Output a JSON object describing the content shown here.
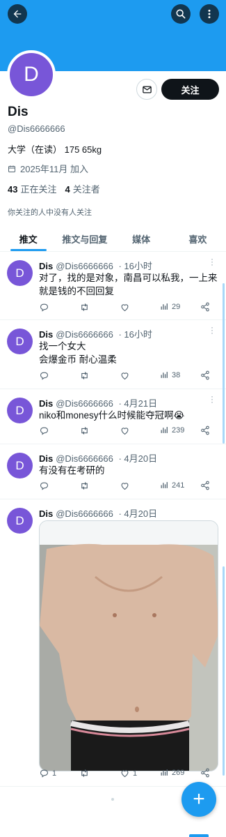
{
  "header": {
    "banner_color": "#1d9bf0",
    "back_icon": "arrow-left-icon",
    "search_icon": "search-icon",
    "more_icon": "more-vertical-icon"
  },
  "profile": {
    "avatar_letter": "D",
    "avatar_color": "#7856d8",
    "name": "Dis",
    "handle": "@Dis6666666",
    "bio": "大学（在读） 175 65kg",
    "joined": "2025年11月 加入",
    "following_count": "43",
    "following_label": "正在关注",
    "followers_count": "4",
    "followers_label": "关注者",
    "mutual_note": "你关注的人中没有人关注",
    "follow_label": "关注",
    "message_icon": "mail-icon"
  },
  "tabs": [
    {
      "label": "推文",
      "active": true
    },
    {
      "label": "推文与回复",
      "active": false
    },
    {
      "label": "媒体",
      "active": false
    },
    {
      "label": "喜欢",
      "active": false
    }
  ],
  "tweets": [
    {
      "name": "Dis",
      "handle": "@Dis6666666",
      "time": "16小时",
      "lines": [
        "对了，找的是对象，南昌可以私我，一上来就是钱的不回回复"
      ],
      "replies": "",
      "retweets": "",
      "likes": "",
      "views": "29"
    },
    {
      "name": "Dis",
      "handle": "@Dis6666666",
      "time": "16小时",
      "lines": [
        "找一个女大",
        "会爆金币 耐心温柔"
      ],
      "replies": "",
      "retweets": "",
      "likes": "",
      "views": "38"
    },
    {
      "name": "Dis",
      "handle": "@Dis6666666",
      "time": "4月21日",
      "lines": [
        "niko和monesy什么时候能夺冠啊😭"
      ],
      "replies": "",
      "retweets": "",
      "likes": "",
      "views": "239"
    },
    {
      "name": "Dis",
      "handle": "@Dis6666666",
      "time": "4月20日",
      "lines": [
        "有没有在考研的"
      ],
      "replies": "",
      "retweets": "",
      "likes": "",
      "views": "241"
    },
    {
      "name": "Dis",
      "handle": "@Dis6666666",
      "time": "4月20日",
      "lines": [],
      "has_photo": true,
      "replies": "1",
      "retweets": "",
      "likes": "1",
      "views": "269"
    }
  ],
  "fab_icon": "plus-icon",
  "fab_label": "+"
}
